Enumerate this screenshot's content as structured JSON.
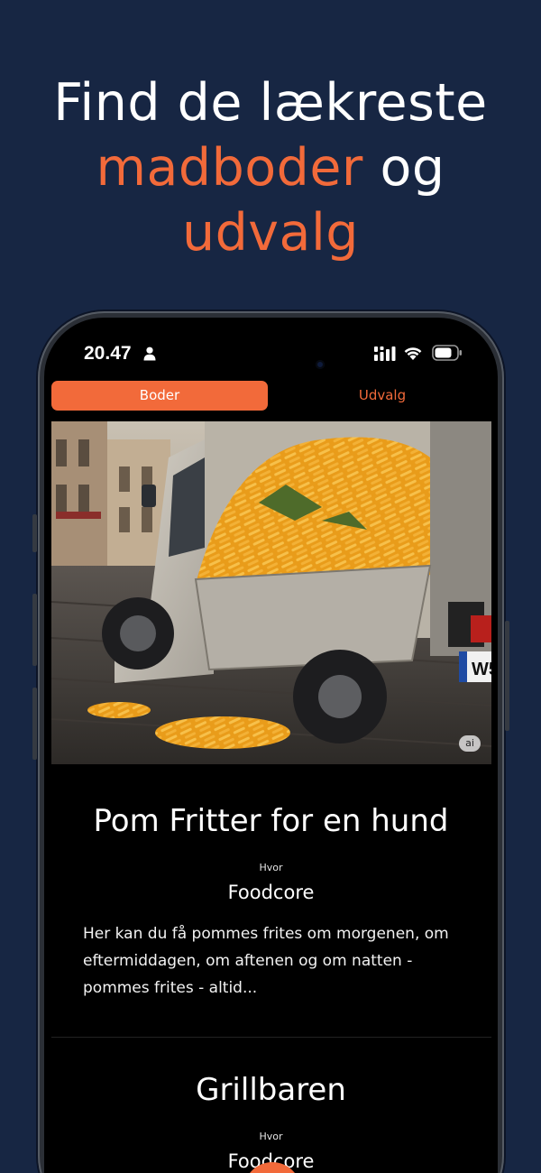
{
  "headline": {
    "line1": "Find de lækreste",
    "accent": "madboder",
    "connector": " og",
    "line3": "udvalg"
  },
  "status_bar": {
    "time": "20.47"
  },
  "tabs": [
    {
      "label": "Boder",
      "active": true
    },
    {
      "label": "Udvalg",
      "active": false
    }
  ],
  "stalls": [
    {
      "title": "Pom Fritter for en hund",
      "where_label": "Hvor",
      "location": "Foodcore",
      "description": "Her kan du få pommes frites om morgenen, om eftermiddagen, om aftenen og om natten - pommes frites - altid...",
      "image_badge": "ai",
      "plate_text": "W5"
    },
    {
      "title": "Grillbaren",
      "where_label": "Hvor",
      "location": "Foodcore"
    }
  ],
  "colors": {
    "background": "#172643",
    "accent": "#f26a3a",
    "screen": "#000000"
  }
}
